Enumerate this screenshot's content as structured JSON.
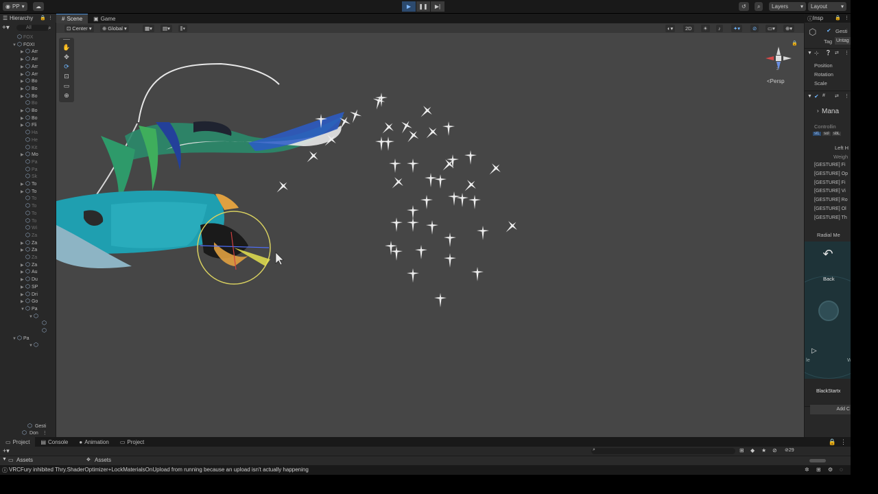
{
  "topbar": {
    "account": "PP",
    "layers": "Layers",
    "layout": "Layout"
  },
  "hierarchy": {
    "tab": "Hierarchy",
    "search": "All",
    "rows": [
      {
        "indent": 3,
        "arrow": "",
        "label": "FOX",
        "dim": true
      },
      {
        "indent": 3,
        "arrow": "▼",
        "label": "FOXI",
        "dim": false
      },
      {
        "indent": 5,
        "arrow": "▶",
        "label": "Arr",
        "dim": false
      },
      {
        "indent": 5,
        "arrow": "▶",
        "label": "Arr",
        "dim": false
      },
      {
        "indent": 5,
        "arrow": "▶",
        "label": "Arr",
        "dim": false
      },
      {
        "indent": 5,
        "arrow": "▶",
        "label": "Arr",
        "dim": false
      },
      {
        "indent": 5,
        "arrow": "▶",
        "label": "Bo",
        "dim": false
      },
      {
        "indent": 5,
        "arrow": "▶",
        "label": "Bo",
        "dim": false
      },
      {
        "indent": 5,
        "arrow": "▶",
        "label": "Bo",
        "dim": false
      },
      {
        "indent": 5,
        "arrow": "",
        "label": "Bo",
        "dim": true
      },
      {
        "indent": 5,
        "arrow": "▶",
        "label": "Bo",
        "dim": false
      },
      {
        "indent": 5,
        "arrow": "▶",
        "label": "Bo",
        "dim": false
      },
      {
        "indent": 5,
        "arrow": "▶",
        "label": "Fli",
        "dim": false
      },
      {
        "indent": 5,
        "arrow": "",
        "label": "Ha",
        "dim": true
      },
      {
        "indent": 5,
        "arrow": "",
        "label": "He",
        "dim": true
      },
      {
        "indent": 5,
        "arrow": "",
        "label": "Kit",
        "dim": true
      },
      {
        "indent": 5,
        "arrow": "▶",
        "label": "Mo",
        "dim": false
      },
      {
        "indent": 5,
        "arrow": "",
        "label": "Pa",
        "dim": true
      },
      {
        "indent": 5,
        "arrow": "",
        "label": "Pa",
        "dim": true
      },
      {
        "indent": 5,
        "arrow": "",
        "label": "Sk",
        "dim": true
      },
      {
        "indent": 5,
        "arrow": "▶",
        "label": "To",
        "dim": false
      },
      {
        "indent": 5,
        "arrow": "▶",
        "label": "To",
        "dim": false
      },
      {
        "indent": 5,
        "arrow": "",
        "label": "To",
        "dim": true
      },
      {
        "indent": 5,
        "arrow": "",
        "label": "To",
        "dim": true
      },
      {
        "indent": 5,
        "arrow": "",
        "label": "To",
        "dim": true
      },
      {
        "indent": 5,
        "arrow": "",
        "label": "To",
        "dim": true
      },
      {
        "indent": 5,
        "arrow": "",
        "label": "Wi",
        "dim": true
      },
      {
        "indent": 5,
        "arrow": "",
        "label": "Za",
        "dim": true
      },
      {
        "indent": 5,
        "arrow": "▶",
        "label": "Za",
        "dim": false
      },
      {
        "indent": 5,
        "arrow": "▶",
        "label": "Za",
        "dim": false
      },
      {
        "indent": 5,
        "arrow": "",
        "label": "Za",
        "dim": true
      },
      {
        "indent": 5,
        "arrow": "▶",
        "label": "Za",
        "dim": false
      },
      {
        "indent": 5,
        "arrow": "▶",
        "label": "Au",
        "dim": false
      },
      {
        "indent": 5,
        "arrow": "▶",
        "label": "Du",
        "dim": false
      },
      {
        "indent": 5,
        "arrow": "▶",
        "label": "SP",
        "dim": false
      },
      {
        "indent": 5,
        "arrow": "▶",
        "label": "Dri",
        "dim": false
      },
      {
        "indent": 5,
        "arrow": "▶",
        "label": "Go",
        "dim": false
      },
      {
        "indent": 5,
        "arrow": "▼",
        "label": "Pa",
        "dim": false
      },
      {
        "indent": 7,
        "arrow": "▼",
        "label": "",
        "dim": false
      },
      {
        "indent": 9,
        "arrow": "",
        "label": "",
        "dim": false
      },
      {
        "indent": 9,
        "arrow": "",
        "label": "",
        "dim": false
      },
      {
        "indent": 3,
        "arrow": "▼",
        "label": "Pa",
        "dim": false
      },
      {
        "indent": 7,
        "arrow": "▼",
        "label": "",
        "dim": false
      }
    ],
    "bottom_rows": [
      "Gesti",
      "Don"
    ]
  },
  "scene": {
    "tabs": [
      "Scene",
      "Game"
    ],
    "pivot": "Center",
    "space": "Global",
    "mode_2d": "2D",
    "persp": "Persp",
    "gizmo_axis": "z"
  },
  "inspector": {
    "tab": "Insp",
    "object_name": "Gesti",
    "tag_label": "Tag",
    "tag_value": "Untag",
    "transform": [
      "Position",
      "Rotation",
      "Scale"
    ],
    "component": "Mana",
    "controller_label": "Controllin",
    "tags": [
      "stL",
      "sol",
      "sbL"
    ],
    "left_hand": "Left H",
    "weight": "Weigh",
    "gestures": [
      "[GESTURE] Fi",
      "[GESTURE] Op",
      "[GESTURE] Fi",
      "[GESTURE] Vi",
      "[GESTURE] Ro",
      "[GESTURE] Ol",
      "[GESTURE] Th"
    ],
    "radial": "Radial Me",
    "back": "Back",
    "menu_item": "BlackStartx",
    "add_component": "Add C",
    "left_cut": "le",
    "right_cut": "W"
  },
  "bottom": {
    "tabs": [
      "Project",
      "Console",
      "Animation",
      "Project"
    ],
    "breadcrumb_left": "Assets",
    "breadcrumb_main": "Assets",
    "count": "29"
  },
  "status": {
    "message": "VRCFury inhibited Thry.ShaderOptimizer+LockMaterialsOnUpload from running because an upload isn't actually happening"
  }
}
